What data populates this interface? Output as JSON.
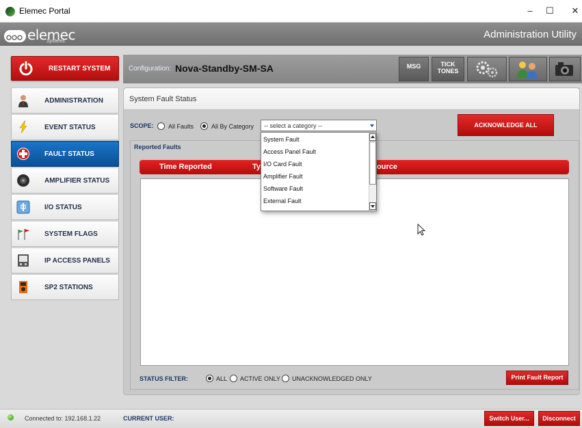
{
  "window": {
    "title": "Elemec Portal",
    "minimize_icon": "minimize-icon",
    "maximize_icon": "maximize-icon",
    "close_icon": "close-icon"
  },
  "header": {
    "logo_text": "elemec",
    "logo_sub": "Systems",
    "app_title": "Administration Utility"
  },
  "sidebar": {
    "restart_label": "RESTART SYSTEM",
    "items": [
      {
        "label": "ADMINISTRATION",
        "icon": "admin-user-icon",
        "active": false
      },
      {
        "label": "EVENT STATUS",
        "icon": "lightning-icon",
        "active": false
      },
      {
        "label": "FAULT STATUS",
        "icon": "red-cross-icon",
        "active": true
      },
      {
        "label": "AMPLIFIER STATUS",
        "icon": "speaker-icon",
        "active": false
      },
      {
        "label": "I/O STATUS",
        "icon": "io-switch-icon",
        "active": false
      },
      {
        "label": "SYSTEM FLAGS",
        "icon": "flags-icon",
        "active": false
      },
      {
        "label": "IP ACCESS PANELS",
        "icon": "access-panel-icon",
        "active": false
      },
      {
        "label": "SP2 STATIONS",
        "icon": "station-icon",
        "active": false
      }
    ]
  },
  "config": {
    "label": "Configuration:",
    "value": "Nova-Standby-SM-SA",
    "msg_label": "MSG",
    "tick_label_1": "TICK",
    "tick_label_2": "TONES"
  },
  "panel": {
    "title": "System Fault Status",
    "scope_label": "SCOPE:",
    "scope_options": [
      "All Faults",
      "All By Category"
    ],
    "scope_selected": "All By Category",
    "category_select": "-- select a category --",
    "ack_all_label": "ACKNOWLEDGE ALL",
    "reported_faults_title": "Reported Faults",
    "columns": [
      "Time Reported",
      "Ty",
      "ource"
    ],
    "status_filter_label": "STATUS FILTER:",
    "filter_options": [
      "ALL",
      "ACTIVE ONLY",
      "UNACKNOWLEDGED ONLY"
    ],
    "filter_selected": "ALL",
    "print_label": "Print Fault Report"
  },
  "dropdown": {
    "items": [
      "System Fault",
      "Access Panel Fault",
      "I/O Card Fault",
      "Amplifier Fault",
      "Software Fault",
      "External Fault"
    ]
  },
  "status": {
    "connected_text": "Connected to: 192.168.1.22",
    "current_user_label": "CURRENT USER:",
    "switch_user_label": "Switch User...",
    "disconnect_label": "Disconnect"
  },
  "colors": {
    "accent_red": "#d01818",
    "active_blue": "#0f5ea8",
    "label_navy": "#1c3766"
  }
}
